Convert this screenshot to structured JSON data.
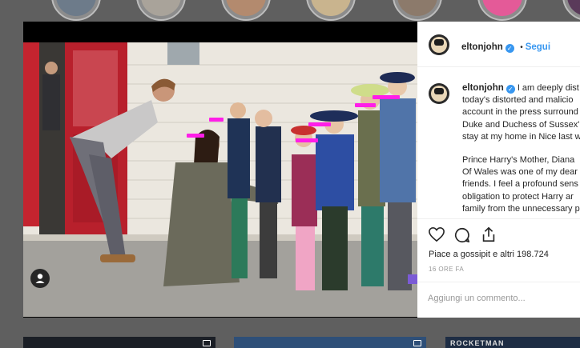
{
  "post": {
    "username": "eltonjohn",
    "verified": true,
    "follow_separator": "•",
    "follow_label": "Segui",
    "caption_paragraphs": [
      [
        "I am deeply dist",
        "today's distorted and malicio",
        "account in the press surround",
        "Duke and Duchess of Sussex'",
        "stay at my home in Nice last w"
      ],
      [
        "Prince Harry's Mother, Diana",
        "Of Wales was one of my dear",
        "friends. I feel a profound sens",
        "obligation to protect Harry ar",
        "family from the unnecessary p"
      ]
    ],
    "likes_text": "Piace a gossipit e altri 198.724",
    "time_ago": "16 ORE FA",
    "comment_placeholder": "Aggiungi un commento..."
  },
  "icons": {
    "like": "heart-icon",
    "comment": "comment-icon",
    "share": "share-icon",
    "tagged_user": "user-tag-icon",
    "verified": "verified-badge-icon"
  },
  "bottom_tiles": {
    "third_label": "ROCKETMAN"
  },
  "colors": {
    "background": "#5f5f5f",
    "link_blue": "#3897f0",
    "text": "#262626",
    "muted": "#999999",
    "censor": "#ff1ee8"
  }
}
